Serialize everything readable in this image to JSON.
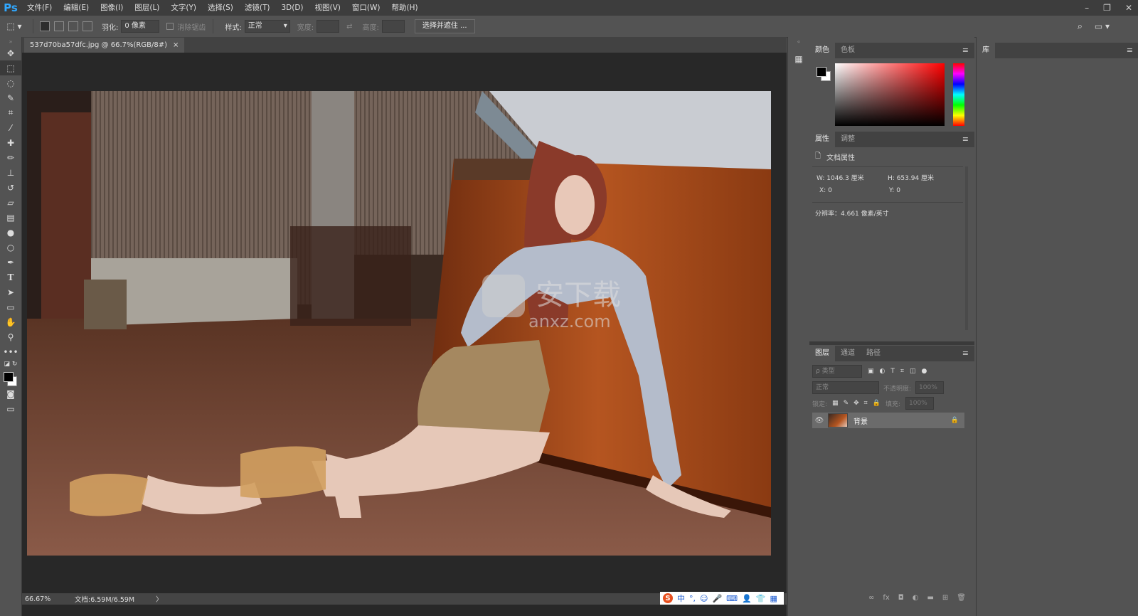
{
  "app": {
    "logo": "Ps"
  },
  "menu": [
    "文件(F)",
    "编辑(E)",
    "图像(I)",
    "图层(L)",
    "文字(Y)",
    "选择(S)",
    "滤镜(T)",
    "3D(D)",
    "视图(V)",
    "窗口(W)",
    "帮助(H)"
  ],
  "options": {
    "feather_label": "羽化:",
    "feather_value": "0 像素",
    "antialias_label": "消除锯齿",
    "style_label": "样式:",
    "style_value": "正常",
    "width_label": "宽度:",
    "height_label": "高度:",
    "select_mask_button": "选择并遮住 ..."
  },
  "document": {
    "tab_title": "537d70ba57dfc.jpg @ 66.7%(RGB/8#)",
    "tab_close": "×",
    "zoom": "66.67%",
    "doc_size": "文档:6.59M/6.59M",
    "status_arrow": "〉",
    "watermark_cn": "安下载",
    "watermark_url": "anxz.com"
  },
  "ime": {
    "items": [
      "S",
      "中",
      "°,",
      "☺",
      "🎤",
      "⌨",
      "👤",
      "👕",
      "▦"
    ]
  },
  "color_panel": {
    "tabs": [
      "颜色",
      "色板"
    ],
    "hue_color": "#ff0000"
  },
  "properties_panel": {
    "tabs": [
      "属性",
      "调整"
    ],
    "section_title": "文档属性",
    "w_label": "W:",
    "w_value": "1046.3 厘米",
    "h_label": "H:",
    "h_value": "653.94 厘米",
    "x_label": "X:",
    "x_value": "0",
    "y_label": "Y:",
    "y_value": "0",
    "resolution": "分辨率：4.661 像素/英寸"
  },
  "layers_panel": {
    "tabs": [
      "图层",
      "通道",
      "路径"
    ],
    "filter_placeholder": "ρ 类型",
    "blend_mode": "正常",
    "opacity_label": "不透明度:",
    "opacity_value": "100%",
    "lock_label": "锁定:",
    "fill_label": "填充:",
    "fill_value": "100%",
    "layers": [
      {
        "name": "背景"
      }
    ],
    "footer_icons": [
      "link-icon",
      "fx-icon",
      "mask-icon",
      "adjustment-icon",
      "folder-icon",
      "new-layer-icon",
      "trash-icon"
    ]
  },
  "library_panel": {
    "tab": "库"
  }
}
